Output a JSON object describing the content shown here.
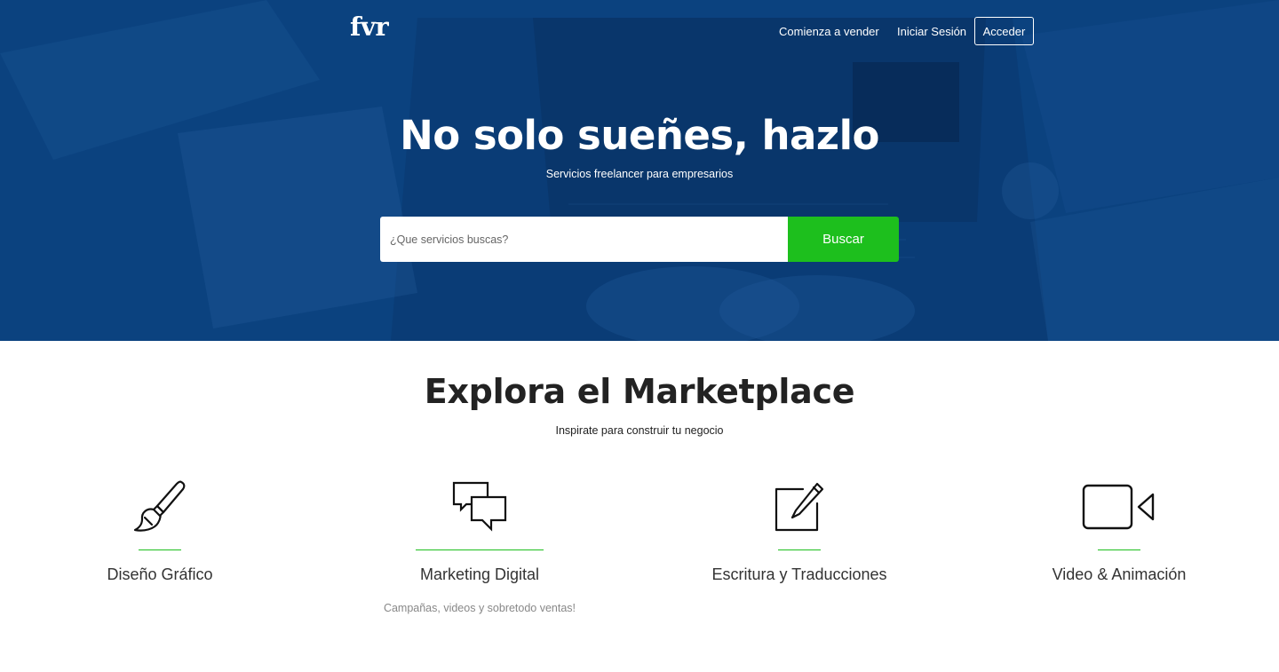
{
  "header": {
    "logo": "fvr",
    "nav": {
      "sell": "Comienza a vender",
      "login": "Iniciar Sesión",
      "access": "Acceder"
    }
  },
  "hero": {
    "title": "No solo sueñes, hazlo",
    "subtitle": "Servicios freelancer para empresarios",
    "search": {
      "placeholder": "¿Que servicios buscas?",
      "button": "Buscar"
    }
  },
  "explore": {
    "title": "Explora el Marketplace",
    "subtitle": "Inspirate para construir tu negocio",
    "categories": [
      {
        "icon": "paintbrush-icon",
        "label": "Diseño Gráfico",
        "description": ""
      },
      {
        "icon": "chat-bubbles-icon",
        "label": "Marketing Digital",
        "description": "Campañas, videos y sobretodo ventas!"
      },
      {
        "icon": "edit-pencil-icon",
        "label": "Escritura y Traducciones",
        "description": ""
      },
      {
        "icon": "video-camera-icon",
        "label": "Video & Animación",
        "description": ""
      }
    ]
  },
  "colors": {
    "hero_blue": "#0a3f7c",
    "accent_green": "#1dbf1d",
    "text_dark": "#222222",
    "text_muted": "#888888"
  }
}
